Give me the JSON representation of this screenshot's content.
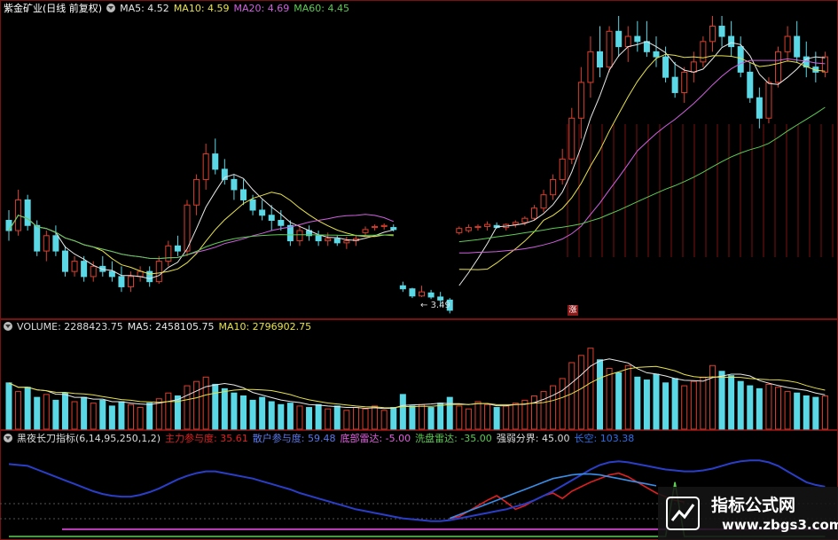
{
  "colors": {
    "up": "#d9402e",
    "down": "#5ad8e6",
    "ma5": "#e8e8e8",
    "ma10": "#e8e24a",
    "ma20": "#d060e0",
    "ma60": "#5ccc52",
    "main_force": "#e02020",
    "retail": "#2a3ec8",
    "wash": "#5ccc52",
    "strong_weak": "#c040c0"
  },
  "price_panel": {
    "title": "紫金矿业(日线 前复权)",
    "ma5": "MA5: 4.52",
    "ma10": "MA10: 4.59",
    "ma20": "MA20: 4.69",
    "ma60": "MA60: 4.45",
    "low_marker": "3.49",
    "zhang_badge": "涨"
  },
  "volume_panel": {
    "volume": "VOLUME: 2288423.75",
    "ma5": "MA5: 2458105.75",
    "ma10": "MA10: 2796902.75"
  },
  "indicator_panel": {
    "name": "黑夜长刀指标(6,14,95,250,1,2)",
    "main_force": "主力参与度: 35.61",
    "retail": "散户参与度: 59.48",
    "bottom_radar": "底部雷达: -5.00",
    "wash_radar": "洗盘雷达: -35.00",
    "strong_weak": "强弱分界: 45.00",
    "long_short": "长空: 103.38"
  },
  "watermark": {
    "title": "指标公式网",
    "url": "www.zbgs3.com"
  },
  "chart_data": [
    {
      "type": "candlestick",
      "title": "紫金矿业(日线 前复权)",
      "ohlc": [
        [
          4.4,
          4.5,
          4.2,
          4.3
        ],
        [
          4.3,
          4.7,
          4.25,
          4.6
        ],
        [
          4.6,
          4.65,
          4.3,
          4.35
        ],
        [
          4.35,
          4.4,
          4.05,
          4.1
        ],
        [
          4.1,
          4.3,
          4.0,
          4.25
        ],
        [
          4.25,
          4.35,
          4.05,
          4.1
        ],
        [
          4.1,
          4.15,
          3.85,
          3.9
        ],
        [
          3.9,
          4.05,
          3.85,
          4.0
        ],
        [
          4.0,
          4.05,
          3.8,
          3.85
        ],
        [
          3.85,
          4.0,
          3.8,
          3.95
        ],
        [
          3.95,
          4.05,
          3.85,
          3.9
        ],
        [
          3.9,
          4.0,
          3.8,
          3.85
        ],
        [
          3.85,
          3.95,
          3.7,
          3.75
        ],
        [
          3.75,
          3.9,
          3.7,
          3.85
        ],
        [
          3.85,
          3.95,
          3.8,
          3.9
        ],
        [
          3.9,
          3.95,
          3.75,
          3.8
        ],
        [
          3.8,
          4.05,
          3.78,
          4.0
        ],
        [
          4.0,
          4.2,
          3.95,
          4.15
        ],
        [
          4.15,
          4.25,
          4.05,
          4.1
        ],
        [
          4.1,
          4.6,
          4.05,
          4.55
        ],
        [
          4.55,
          4.85,
          4.45,
          4.8
        ],
        [
          4.8,
          5.15,
          4.7,
          5.05
        ],
        [
          5.05,
          5.2,
          4.85,
          4.9
        ],
        [
          4.9,
          5.0,
          4.75,
          4.8
        ],
        [
          4.8,
          4.85,
          4.6,
          4.7
        ],
        [
          4.7,
          4.8,
          4.55,
          4.6
        ],
        [
          4.6,
          4.65,
          4.45,
          4.5
        ],
        [
          4.5,
          4.6,
          4.4,
          4.45
        ],
        [
          4.45,
          4.55,
          4.3,
          4.4
        ],
        [
          4.4,
          4.5,
          4.3,
          4.35
        ],
        [
          4.35,
          4.4,
          4.15,
          4.2
        ],
        [
          4.2,
          4.35,
          4.15,
          4.3
        ],
        [
          4.3,
          4.35,
          4.2,
          4.25
        ],
        [
          4.25,
          4.3,
          4.15,
          4.2
        ],
        [
          4.2,
          4.28,
          4.15,
          4.22
        ],
        [
          4.22,
          4.25,
          4.15,
          4.18
        ],
        [
          4.18,
          4.24,
          4.12,
          4.2
        ],
        [
          4.2,
          4.26,
          4.15,
          4.22
        ],
        [
          4.28,
          4.34,
          4.24,
          4.31
        ],
        [
          4.33,
          4.36,
          4.3,
          4.34
        ],
        [
          4.34,
          4.37,
          4.31,
          4.35
        ],
        [
          4.33,
          4.36,
          4.29,
          4.31
        ],
        [
          3.76,
          3.8,
          3.7,
          3.73
        ],
        [
          3.73,
          3.74,
          3.64,
          3.66
        ],
        [
          3.66,
          3.76,
          3.65,
          3.7
        ],
        [
          3.69,
          3.72,
          3.63,
          3.65
        ],
        [
          3.65,
          3.7,
          3.55,
          3.62
        ],
        [
          3.62,
          3.64,
          3.49,
          3.52
        ],
        [
          4.28,
          4.34,
          4.26,
          4.32
        ],
        [
          4.3,
          4.36,
          4.28,
          4.33
        ],
        [
          4.33,
          4.36,
          4.3,
          4.34
        ],
        [
          4.34,
          4.39,
          4.3,
          4.36
        ],
        [
          4.35,
          4.38,
          4.32,
          4.33
        ],
        [
          4.33,
          4.37,
          4.3,
          4.36
        ],
        [
          4.36,
          4.4,
          4.33,
          4.38
        ],
        [
          4.38,
          4.44,
          4.35,
          4.42
        ],
        [
          4.42,
          4.55,
          4.4,
          4.52
        ],
        [
          4.52,
          4.7,
          4.48,
          4.65
        ],
        [
          4.65,
          4.85,
          4.6,
          4.8
        ],
        [
          4.8,
          5.1,
          4.75,
          5.0
        ],
        [
          5.0,
          5.5,
          4.95,
          5.4
        ],
        [
          5.4,
          5.9,
          5.2,
          5.75
        ],
        [
          5.75,
          6.2,
          5.6,
          6.05
        ],
        [
          6.05,
          6.3,
          5.8,
          5.9
        ],
        [
          5.9,
          6.3,
          5.85,
          6.25
        ],
        [
          6.25,
          6.4,
          6.0,
          6.1
        ],
        [
          6.1,
          6.3,
          5.95,
          6.2
        ],
        [
          6.2,
          6.35,
          6.05,
          6.15
        ],
        [
          6.15,
          6.35,
          6.0,
          6.05
        ],
        [
          6.05,
          6.2,
          5.9,
          6.0
        ],
        [
          6.0,
          6.1,
          5.75,
          5.8
        ],
        [
          5.8,
          5.95,
          5.6,
          5.65
        ],
        [
          5.65,
          5.9,
          5.55,
          5.85
        ],
        [
          5.85,
          6.05,
          5.75,
          5.95
        ],
        [
          5.95,
          6.2,
          5.9,
          6.15
        ],
        [
          6.15,
          6.4,
          6.05,
          6.3
        ],
        [
          6.3,
          6.4,
          6.1,
          6.2
        ],
        [
          6.2,
          6.35,
          6.0,
          6.1
        ],
        [
          6.1,
          6.2,
          5.8,
          5.85
        ],
        [
          5.85,
          5.95,
          5.55,
          5.6
        ],
        [
          5.6,
          5.7,
          5.3,
          5.4
        ],
        [
          5.4,
          5.8,
          5.35,
          5.75
        ],
        [
          5.75,
          6.1,
          5.7,
          6.05
        ],
        [
          6.05,
          6.3,
          5.95,
          6.2
        ],
        [
          6.2,
          6.35,
          5.95,
          6.0
        ],
        [
          6.0,
          6.15,
          5.8,
          5.9
        ],
        [
          5.9,
          6.05,
          5.75,
          5.85
        ],
        [
          5.85,
          6.05,
          5.8,
          6.0
        ]
      ],
      "ylim": [
        3.45,
        6.4
      ]
    },
    {
      "type": "bar",
      "title": "VOLUME",
      "values": [
        3.2,
        2.6,
        2.9,
        2.2,
        2.4,
        2.0,
        2.5,
        1.9,
        2.2,
        1.8,
        2.0,
        1.6,
        1.9,
        1.7,
        1.5,
        1.8,
        2.1,
        2.5,
        2.3,
        3.0,
        3.3,
        3.6,
        3.1,
        2.8,
        2.5,
        2.3,
        2.0,
        2.2,
        1.9,
        1.7,
        1.8,
        1.6,
        1.5,
        1.7,
        1.4,
        1.6,
        1.3,
        1.5,
        1.4,
        1.6,
        1.3,
        1.5,
        2.4,
        1.6,
        1.7,
        1.5,
        1.8,
        2.2,
        1.6,
        1.4,
        1.9,
        1.7,
        1.5,
        1.6,
        1.8,
        2.0,
        2.3,
        2.6,
        3.0,
        3.5,
        4.6,
        5.1,
        5.6,
        4.8,
        4.2,
        3.9,
        4.4,
        3.6,
        3.4,
        3.8,
        3.2,
        3.5,
        3.0,
        3.3,
        3.6,
        4.4,
        4.0,
        3.7,
        3.3,
        3.0,
        2.8,
        3.1,
        2.9,
        2.6,
        2.5,
        2.3,
        2.2,
        2.3
      ],
      "ylim": [
        0,
        6.5
      ]
    },
    {
      "type": "line",
      "title": "黑夜长刀指标(6,14,95,250,1,2)",
      "series": [
        {
          "name": "主力参与度",
          "values": [
            null,
            null,
            null,
            null,
            null,
            null,
            null,
            null,
            null,
            null,
            null,
            null,
            null,
            null,
            null,
            null,
            null,
            null,
            null,
            null,
            null,
            null,
            null,
            null,
            null,
            null,
            null,
            null,
            null,
            null,
            null,
            null,
            null,
            null,
            null,
            null,
            null,
            null,
            null,
            null,
            null,
            null,
            null,
            null,
            null,
            null,
            null,
            20,
            22,
            28,
            34,
            40,
            45,
            38,
            30,
            34,
            40,
            45,
            48,
            42,
            50,
            55,
            60,
            64,
            68,
            70,
            66,
            60,
            54,
            48,
            44,
            40,
            38
          ]
        },
        {
          "name": "散户参与度",
          "values": [
            80,
            79,
            78,
            74,
            70,
            66,
            62,
            58,
            54,
            50,
            47,
            45,
            44,
            44,
            46,
            49,
            53,
            58,
            63,
            67,
            70,
            72,
            72,
            70,
            68,
            66,
            64,
            61,
            58,
            55,
            52,
            48,
            45,
            42,
            39,
            36,
            33,
            30,
            28,
            26,
            24,
            22,
            20,
            19,
            18,
            17,
            17,
            18,
            20,
            22,
            24,
            26,
            28,
            30,
            33,
            36,
            40,
            45,
            50,
            56,
            62,
            68,
            74,
            79,
            82,
            83,
            82,
            80,
            78,
            76,
            74,
            73,
            72,
            72,
            73,
            75,
            78,
            81,
            83,
            84,
            84,
            82,
            78,
            72,
            66,
            60,
            57,
            55
          ]
        },
        {
          "name": "底部雷达",
          "values": [
            null,
            null,
            null,
            null,
            null,
            null,
            null,
            null,
            null,
            null,
            null,
            null,
            null,
            null,
            null,
            null,
            null,
            null,
            null,
            null,
            null,
            null,
            null,
            null,
            null,
            null,
            null,
            null,
            null,
            null,
            null,
            null,
            null,
            null,
            null,
            null,
            null,
            null,
            null,
            null,
            null,
            null,
            null,
            null,
            null,
            null,
            null,
            20,
            24,
            28,
            32,
            36,
            40,
            44,
            48,
            52,
            56,
            60,
            64,
            66,
            68,
            69,
            69,
            68,
            66,
            64,
            62,
            60,
            58,
            56
          ]
        },
        {
          "name": "洗盘雷达",
          "values": [
            0,
            0,
            0,
            0,
            0,
            0,
            0,
            0,
            0,
            0,
            0,
            0,
            0,
            0,
            0,
            0,
            0,
            0,
            0,
            0,
            0,
            0,
            0,
            0,
            0,
            0,
            0,
            0,
            0,
            0,
            0,
            0,
            0,
            0,
            0,
            0,
            0,
            0,
            0,
            0,
            0,
            0,
            0,
            0,
            0,
            0,
            0,
            0,
            0,
            0,
            0,
            0,
            0,
            0,
            0,
            0,
            0,
            0,
            0,
            0,
            0,
            0,
            0,
            0,
            0,
            0,
            0,
            0,
            0,
            0,
            0,
            60,
            0,
            0,
            0,
            0,
            0,
            0,
            0,
            0,
            0,
            0,
            0,
            0,
            0,
            0,
            0,
            0
          ]
        },
        {
          "name": "强弱分界",
          "values": []
        }
      ],
      "ylim": [
        0,
        100
      ]
    }
  ]
}
